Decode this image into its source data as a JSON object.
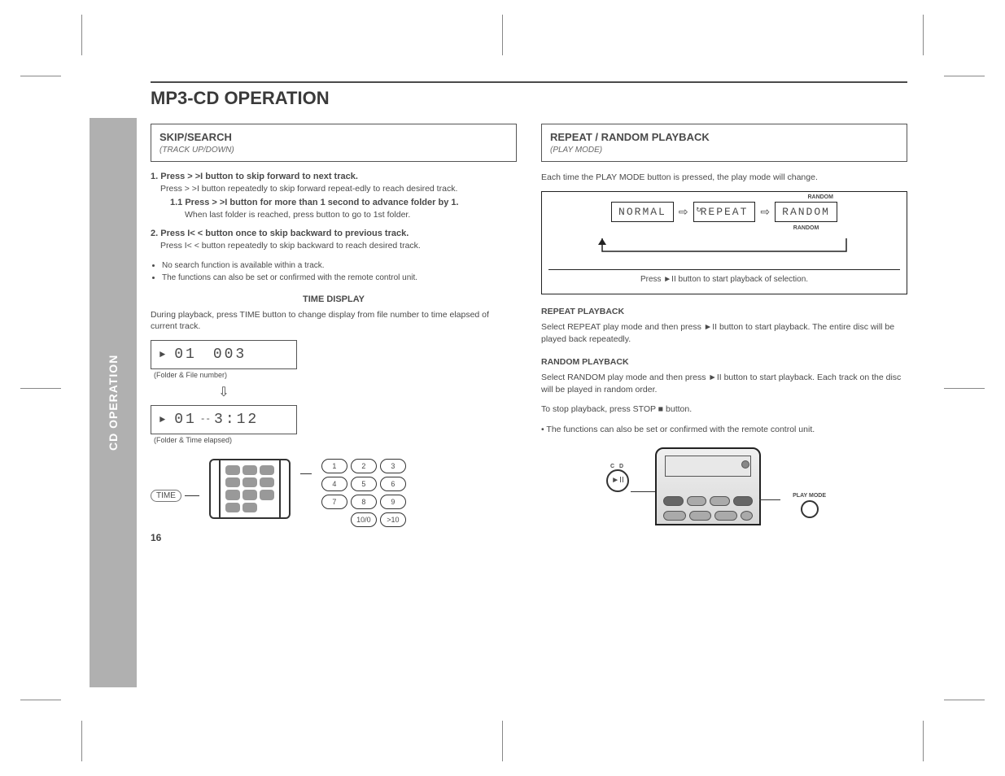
{
  "sidebar_label": "CD OPERATION",
  "page_title": "MP3-CD OPERATION",
  "page_number": "16",
  "left": {
    "box_title": "SKIP/SEARCH",
    "box_sub": "(TRACK UP/DOWN)",
    "step1_h": "1. Press  > >I  button to skip forward to next track.",
    "step1_body": "Press  > >I  button repeatedly to skip forward repeat-edly to reach desired track.",
    "step1_sub_h": "1.1 Press  > >I  button for more than 1 second to advance folder by 1.",
    "step1_sub_body": "When last folder is reached, press button to go to 1st folder.",
    "step2_h": "2. Press  I< <  button once to skip backward to previous track.",
    "step2_body": "Press  I< <  button repeatedly to skip backward to reach desired track.",
    "bullets": [
      "No search function is available within a track.",
      "The functions can also be set or confirmed with the remote control unit."
    ],
    "time_label": "TIME DISPLAY",
    "time_desc": "During playback, press TIME button to change display from file number to time elapsed of current track.",
    "lcd1_folder": "01",
    "lcd1_file": "003",
    "lcd1_caption": "(Folder & File number)",
    "lcd2_folder": "01",
    "lcd2_time": "3:12",
    "lcd2_caption": "(Folder & Time elapsed)",
    "remote_label": "TIME",
    "keypad": [
      "1",
      "2",
      "3",
      "4",
      "5",
      "6",
      "7",
      "8",
      "9",
      "",
      "10/0",
      ">10"
    ]
  },
  "right": {
    "box_title": "REPEAT / RANDOM PLAYBACK",
    "box_sub": "(PLAY MODE)",
    "intro": "Each time the PLAY MODE button is pressed, the play mode will change.",
    "modes": {
      "m1": "NORMAL",
      "m2": "REPEAT",
      "m3": "RANDOM"
    },
    "mode_tag_under": "RANDOM",
    "mode_tag_over": "RANDOM",
    "footer": "Press ►II button to start playback of selection.",
    "rep_h": "REPEAT PLAYBACK",
    "rep_body": "Select REPEAT play mode and then press ►II button to start playback. The entire disc will be played back repeatedly.",
    "ran_h": "RANDOM PLAYBACK",
    "ran_body": "Select RANDOM play mode and then press ►II button to start playback. Each track on the disc will be played in random order.",
    "stop_line": "To stop playback, press STOP ■ button.",
    "note_line": "• The functions can also be set or confirmed with the remote control unit.",
    "cd_label": "C D",
    "cd_glyph": "►II",
    "pm_label": "PLAY MODE"
  }
}
